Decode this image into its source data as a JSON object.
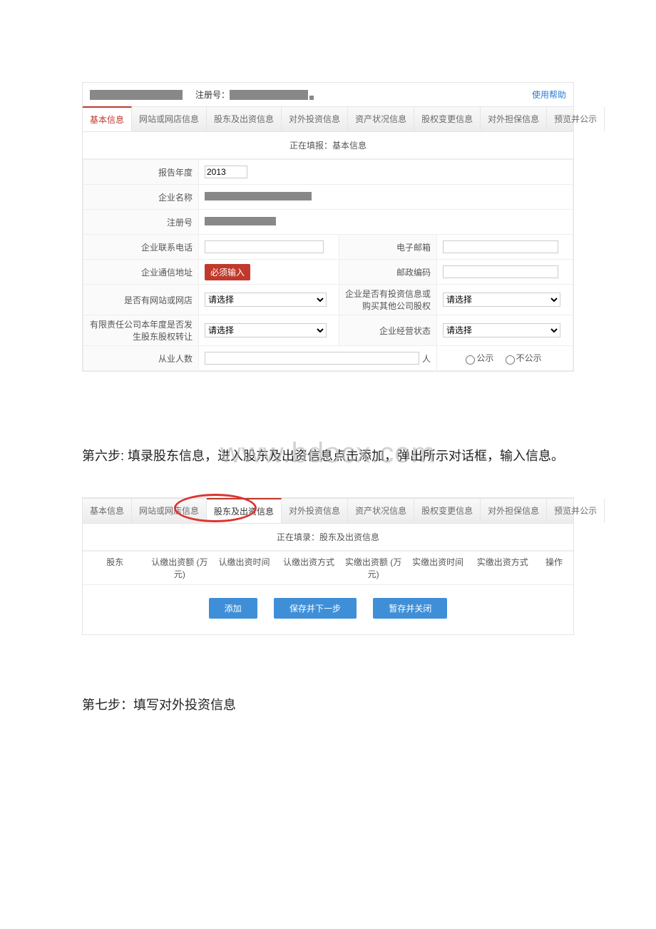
{
  "header": {
    "reg_label": "注册号：",
    "help": "使用帮助"
  },
  "tabs": [
    "基本信息",
    "网站或网店信息",
    "股东及出资信息",
    "对外投资信息",
    "资产状况信息",
    "股权变更信息",
    "对外担保信息",
    "预览并公示"
  ],
  "subhead1": "正在填报：基本信息",
  "form": {
    "report_year_label": "报告年度",
    "report_year": "2013",
    "company_name_label": "企业名称",
    "reg_no_label": "注册号",
    "phone_label": "企业联系电话",
    "email_label": "电子邮箱",
    "address_label": "企业通信地址",
    "address_badge": "必须输入",
    "postcode_label": "邮政编码",
    "has_website_label": "是否有网站或网店",
    "has_invest_label": "企业是否有投资信息或购买其他公司股权",
    "llc_transfer_label": "有限责任公司本年度是否发生股东股权转让",
    "biz_status_label": "企业经营状态",
    "select_placeholder": "请选择",
    "employees_label": "从业人数",
    "employees_unit": "人",
    "radio_public": "公示",
    "radio_private": "不公示"
  },
  "step6": "第六步: 填录股东信息，进入股东及出资信息点击添加，弹出所示对话框，输入信息。",
  "watermark": "www.bdocx.com",
  "subhead2": "正在填录：股东及出资信息",
  "table_headers": [
    "股东",
    "认缴出资额 (万元)",
    "认缴出资时间",
    "认缴出资方式",
    "实缴出资额 (万元)",
    "实缴出资时间",
    "实缴出资方式",
    "操作"
  ],
  "buttons": {
    "add": "添加",
    "save_next": "保存并下一步",
    "save_close": "暂存并关闭"
  },
  "step7": "第七步：填写对外投资信息"
}
